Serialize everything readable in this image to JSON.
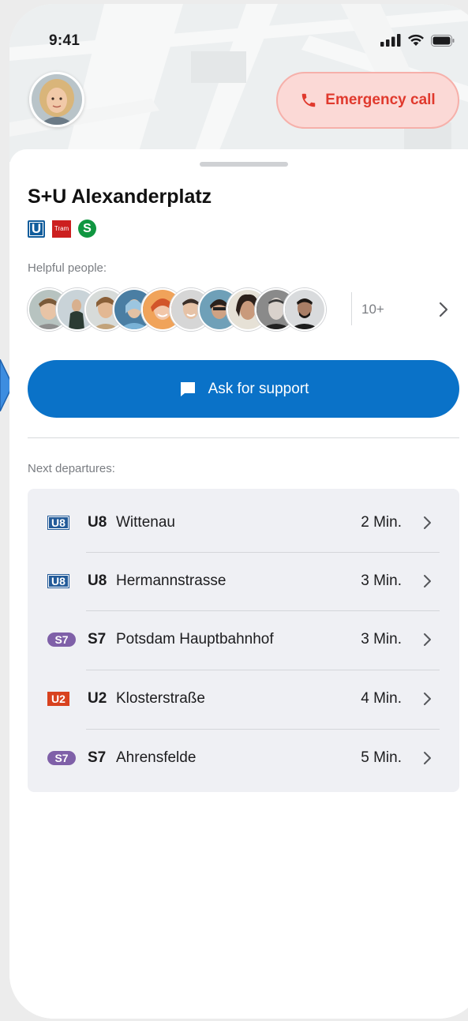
{
  "status_bar": {
    "time": "9:41"
  },
  "header": {
    "emergency_label": "Emergency call"
  },
  "station": {
    "name": "S+U Alexanderplatz",
    "line_icons": {
      "u": "U",
      "tram": "Tram",
      "s": "S"
    }
  },
  "helpful_people": {
    "label": "Helpful people:",
    "more_count": "10+"
  },
  "support": {
    "button_label": "Ask for support"
  },
  "departures": {
    "label": "Next departures:",
    "rows": [
      {
        "badge": "U8",
        "badge_style": "u8",
        "line": "U8",
        "destination": "Wittenau",
        "minutes": "2 Min."
      },
      {
        "badge": "U8",
        "badge_style": "u8",
        "line": "U8",
        "destination": "Hermannstrasse",
        "minutes": "3 Min."
      },
      {
        "badge": "S7",
        "badge_style": "s7",
        "line": "S7",
        "destination": "Potsdam Hauptbahnhof",
        "minutes": "3 Min."
      },
      {
        "badge": "U2",
        "badge_style": "u2",
        "line": "U2",
        "destination": "Klosterstraße",
        "minutes": "4 Min."
      },
      {
        "badge": "S7",
        "badge_style": "s7",
        "line": "S7",
        "destination": "Ahrensfelde",
        "minutes": "5 Min."
      }
    ]
  },
  "colors": {
    "primary": "#0a72c8",
    "emergency": "#e0392d",
    "emergency_bg": "#fbd9d6",
    "u8": "#235b99",
    "u2": "#d8421f",
    "s7": "#7f60a8",
    "pointer": "#3d8de0"
  }
}
